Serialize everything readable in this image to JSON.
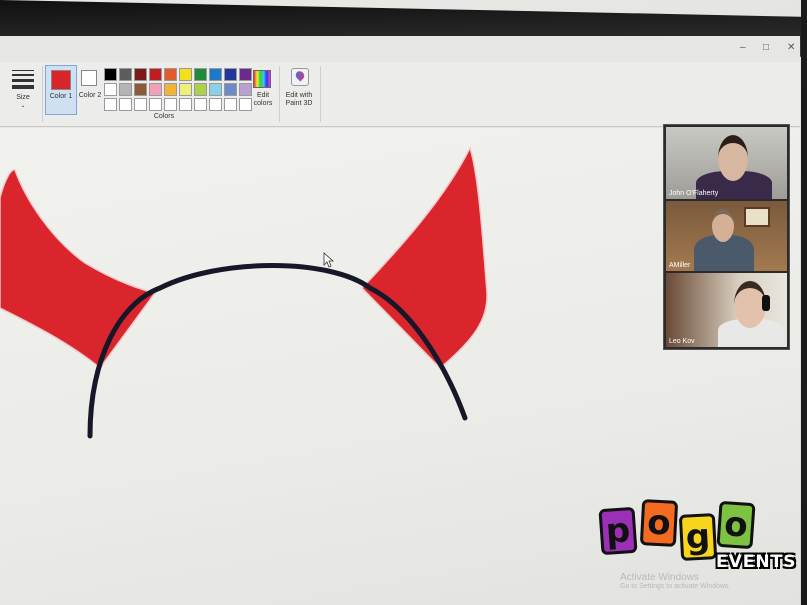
{
  "window": {
    "minimize": "–",
    "maximize": "□",
    "close": "✕"
  },
  "ribbon": {
    "size_label": "Size",
    "color1_label": "Color 1",
    "color2_label": "Color 2",
    "colors_group_label": "Colors",
    "edit_colors_label": "Edit colors",
    "edit_paint3d_label": "Edit with Paint 3D",
    "color1_value": "#d9242a",
    "color2_value": "#ffffff",
    "palette": [
      "#000000",
      "#5c5c5c",
      "#7a1a1a",
      "#c01c24",
      "#e35b2b",
      "#f2e01a",
      "#1e8a3a",
      "#1f78c8",
      "#24369a",
      "#6c2a8a",
      "#ffffff",
      "#b4b4b4",
      "#8a5a3a",
      "#f0a0b8",
      "#f0b43a",
      "#eef07a",
      "#a8d24a",
      "#8ad0e8",
      "#6a8ac8",
      "#b8a0d0",
      "#ffffff",
      "#ffffff",
      "#ffffff",
      "#ffffff",
      "#ffffff",
      "#ffffff",
      "#ffffff",
      "#ffffff",
      "#ffffff",
      "#ffffff"
    ]
  },
  "canvas": {
    "horn_color": "#d9252b",
    "headband_color": "#16182a"
  },
  "video_call": {
    "participants": [
      {
        "name": "John O'Flaherty"
      },
      {
        "name": "AMiller"
      },
      {
        "name": "Leo Kov"
      }
    ]
  },
  "logo": {
    "letters": [
      "p",
      "o",
      "g",
      "o"
    ],
    "events": "EVENTS"
  },
  "watermark": {
    "line1": "Activate Windows",
    "line2": "Go to Settings to activate Windows."
  }
}
